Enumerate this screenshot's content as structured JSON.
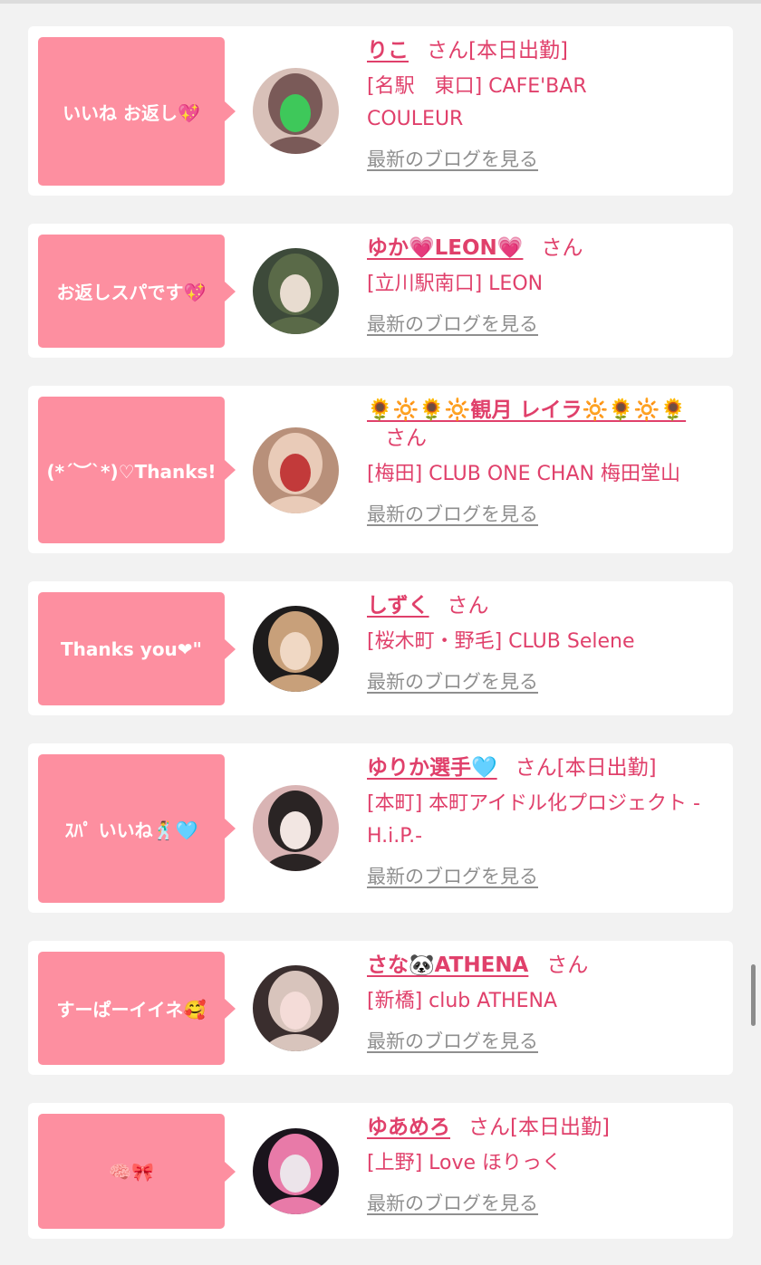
{
  "cards": [
    {
      "bubble": "いいね お返し💖",
      "name": "りこ",
      "san": "さん",
      "status": "[本日出勤]",
      "shop": "[名駅　東口] CAFE'BAR COULEUR",
      "blog": "最新のブログを見る",
      "avatar": [
        "#d8c0b8",
        "#7a5a58",
        "#3ec85a"
      ]
    },
    {
      "bubble": "お返しスパです💖",
      "name": "ゆか💗LEON💗",
      "san": "さん",
      "status": "",
      "shop": "[立川駅南口] LEON",
      "blog": "最新のブログを見る",
      "avatar": [
        "#3d4a3a",
        "#5a6a48",
        "#e8dcd0"
      ]
    },
    {
      "bubble": "(*´︶`*)♡Thanks!",
      "name": "🌻🔆🌻🔆観月 レイラ🔆🌻🔆🌻",
      "san": "さん",
      "status": "",
      "shop": "[梅田] CLUB ONE CHAN 梅田堂山",
      "blog": "最新のブログを見る",
      "avatar": [
        "#b8907a",
        "#e9cbb8",
        "#c23a3a"
      ]
    },
    {
      "bubble": "Thanks you❤\"",
      "name": "しずく",
      "san": "さん",
      "status": "",
      "shop": "[桜木町・野毛] CLUB Selene",
      "blog": "最新のブログを見る",
      "avatar": [
        "#1e1c1c",
        "#c8a07a",
        "#f0d8c4"
      ]
    },
    {
      "bubble": "ｽﾊﾟ いいね🕺🩵",
      "name": "ゆりか選手🩵",
      "san": "さん",
      "status": "[本日出勤]",
      "shop": "[本町] 本町アイドル化プロジェクト -H.i.P.-",
      "blog": "最新のブログを見る",
      "avatar": [
        "#d9b4b4",
        "#2a2424",
        "#f2e6e2"
      ]
    },
    {
      "bubble": "すーぱーイイネ🥰",
      "name": "さな🐼ATHENA",
      "san": "さん",
      "status": "",
      "shop": "[新橋] club ATHENA",
      "blog": "最新のブログを見る",
      "avatar": [
        "#3a2e2e",
        "#d8c4bc",
        "#f4dcd8"
      ]
    },
    {
      "bubble": "🧠🎀",
      "name": "ゆあめろ",
      "san": "さん",
      "status": "[本日出勤]",
      "shop": "[上野] Love ほりっく",
      "blog": "最新のブログを見る",
      "avatar": [
        "#1a141c",
        "#e87aa8",
        "#ece4ea"
      ]
    }
  ]
}
